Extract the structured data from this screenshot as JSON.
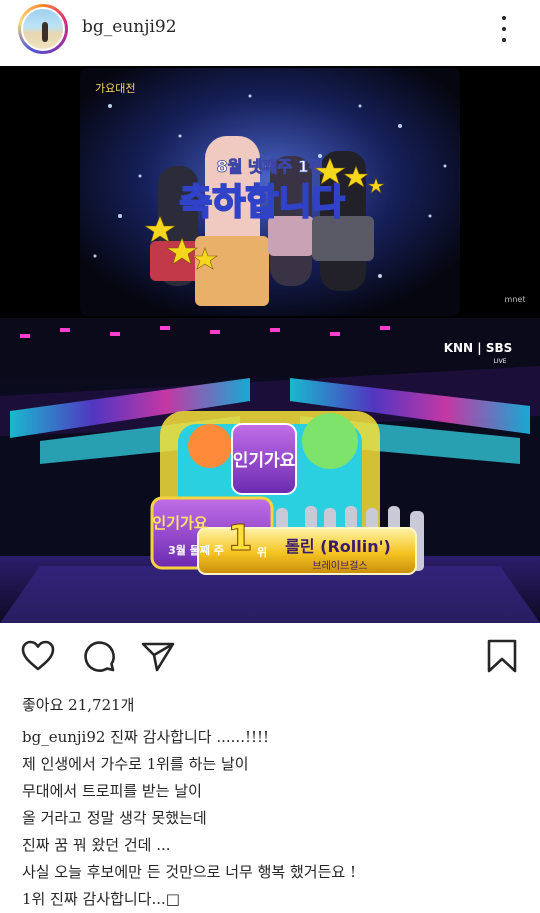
{
  "post": {
    "username": "bg_eunji92",
    "likes_label": "좋아요 21,721개"
  },
  "photo": {
    "top": {
      "broadcaster_logo": "가요대전",
      "overlay_small": "8월 넷째주 1위",
      "overlay_big": "축하합니다"
    },
    "bottom": {
      "channel_logo": "KNN | SBS",
      "channel_sub": "LIVE",
      "show_logo": "인기가요",
      "banner_show": "인기가요",
      "banner_week": "3월 둘째 주",
      "banner_rank": "1",
      "banner_rank_suffix": "위",
      "banner_song": "롤린 (Rollin')",
      "banner_artist": "브레이브걸스"
    }
  },
  "caption": {
    "username": "bg_eunji92",
    "lines": [
      "진짜 감사합니다 ......!!!!",
      "제 인생에서 가수로 1위를 하는 날이",
      "무대에서 트로피를 받는 날이",
      "올 거라고 정말 생각 못했는데",
      "진짜 꿈 꿔 왔던 건데 ...",
      "사실 오늘 후보에만 든 것만으로 너무 행복 했거든요 !",
      "1위 진짜 감사합니다...□"
    ]
  },
  "icons": {
    "like": "heart-icon",
    "comment": "comment-icon",
    "share": "send-icon",
    "save": "bookmark-icon",
    "more": "more-vertical-icon"
  }
}
